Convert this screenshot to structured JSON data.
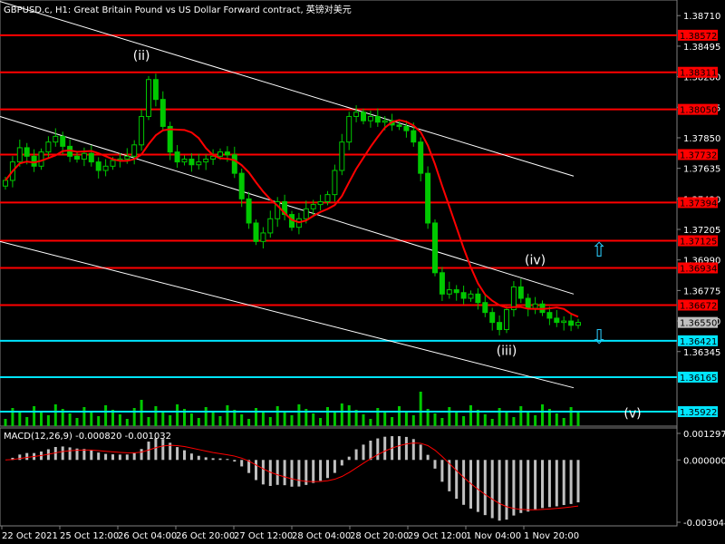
{
  "title": "GBPUSD.c, H1:  Great Britain Pound vs US Dollar Forward contract, 英镑对美元",
  "macd_title": "MACD(12,26,9) -0.000820 -0.001032",
  "icons": {
    "up": "up-arrow-icon",
    "down": "down-arrow-icon"
  },
  "colors": {
    "background": "#000000",
    "bull": "#00c800",
    "bear": "#00c800",
    "level_red": "#ff0000",
    "level_cyan": "#00e5ff",
    "ma": "#ff0000",
    "macd_hist": "#c0c0c0",
    "macd_signal": "#ff0000",
    "channel": "#ffffff"
  },
  "chart_data": {
    "type": "candlestick",
    "symbol": "GBPUSD.c",
    "timeframe": "H1",
    "price_axis": {
      "ticks": [
        "1.38710",
        "1.38495",
        "1.38280",
        "1.38065",
        "1.37850",
        "1.37635",
        "1.37420",
        "1.37205",
        "1.36990",
        "1.36775",
        "1.36560",
        "1.36345"
      ],
      "range": [
        1.3582,
        1.3882
      ]
    },
    "time_axis": {
      "labels": [
        "22 Oct 2021",
        "25 Oct 12:00",
        "26 Oct 04:00",
        "26 Oct 20:00",
        "27 Oct 12:00",
        "28 Oct 04:00",
        "28 Oct 20:00",
        "29 Oct 12:00",
        "1 Nov 04:00",
        "1 Nov 20:00"
      ]
    },
    "current_price": "1.36550",
    "horizontal_levels": [
      {
        "price": 1.38572,
        "label": "1.38572",
        "color": "red"
      },
      {
        "price": 1.38311,
        "label": "1.38311",
        "color": "red"
      },
      {
        "price": 1.3805,
        "label": "1.38050",
        "color": "red"
      },
      {
        "price": 1.37732,
        "label": "1.37732",
        "color": "red"
      },
      {
        "price": 1.37394,
        "label": "1.37394",
        "color": "red"
      },
      {
        "price": 1.37125,
        "label": "1.37125",
        "color": "red"
      },
      {
        "price": 1.36934,
        "label": "1.36934",
        "color": "red"
      },
      {
        "price": 1.36672,
        "label": "1.36672",
        "color": "red"
      },
      {
        "price": 1.36421,
        "label": "1.36421",
        "color": "cyan"
      },
      {
        "price": 1.36165,
        "label": "1.36165",
        "color": "cyan"
      },
      {
        "price": 1.35922,
        "label": "1.35922",
        "color": "cyan"
      }
    ],
    "wave_labels": [
      "(ii)",
      "(iii)",
      "(iv)",
      "(v)"
    ],
    "closes": [
      1.3755,
      1.3768,
      1.3778,
      1.3772,
      1.3765,
      1.3775,
      1.3782,
      1.3786,
      1.3779,
      1.3772,
      1.377,
      1.3774,
      1.3768,
      1.3762,
      1.3765,
      1.3769,
      1.377,
      1.3772,
      1.378,
      1.38,
      1.3826,
      1.3812,
      1.3793,
      1.3775,
      1.3768,
      1.377,
      1.3766,
      1.3768,
      1.377,
      1.3772,
      1.3775,
      1.3773,
      1.376,
      1.3742,
      1.3725,
      1.3712,
      1.3718,
      1.3728,
      1.374,
      1.3731,
      1.3722,
      1.3728,
      1.3735,
      1.3738,
      1.374,
      1.3745,
      1.3762,
      1.3782,
      1.38,
      1.3803,
      1.3797,
      1.38,
      1.3796,
      1.3797,
      1.3794,
      1.3793,
      1.379,
      1.3782,
      1.376,
      1.3725,
      1.369,
      1.3675,
      1.3678,
      1.3676,
      1.3672,
      1.3675,
      1.3669,
      1.3662,
      1.3655,
      1.365,
      1.3664,
      1.368,
      1.3672,
      1.3665,
      1.3668,
      1.3662,
      1.3658,
      1.3655,
      1.3656,
      1.3653,
      1.3655
    ],
    "indicator": {
      "name": "MACD(12,26,9)",
      "main": -0.00082,
      "signal": -0.001032,
      "axis_ticks": [
        "0.001297",
        "0.000000",
        "-0.003044"
      ]
    }
  }
}
